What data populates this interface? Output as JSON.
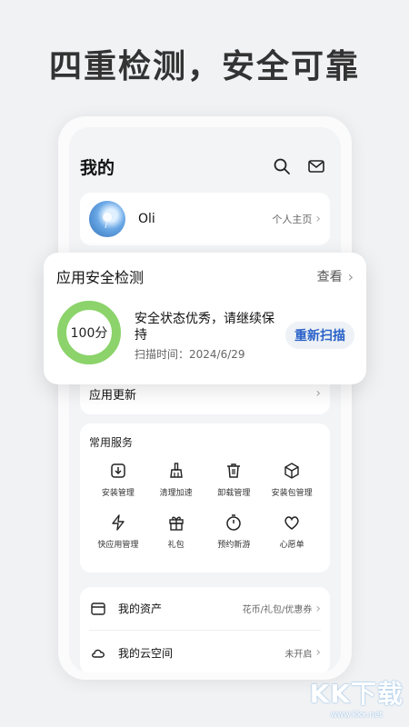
{
  "headline": "四重检测，安全可靠",
  "header": {
    "title": "我的",
    "icons": [
      "search-icon",
      "mail-icon"
    ]
  },
  "profile": {
    "name": "Oli",
    "homepage_link": "个人主页"
  },
  "security_popup": {
    "title": "应用安全检测",
    "view_link": "查看",
    "score": "100分",
    "score_percent": 100,
    "status": "安全状态优秀，请继续保持",
    "scan_time": "扫描时间：2024/6/29",
    "rescan_button": "重新扫描",
    "accent_color": "#8bd36a"
  },
  "app_update": {
    "label": "应用更新"
  },
  "services": {
    "title": "常用服务",
    "items": [
      {
        "label": "安装管理",
        "icon": "install-icon"
      },
      {
        "label": "清理加速",
        "icon": "broom-icon"
      },
      {
        "label": "卸载管理",
        "icon": "trash-icon"
      },
      {
        "label": "安装包管理",
        "icon": "package-icon"
      },
      {
        "label": "快应用管理",
        "icon": "lightning-icon"
      },
      {
        "label": "礼包",
        "icon": "gift-icon"
      },
      {
        "label": "预约新游",
        "icon": "timer-icon"
      },
      {
        "label": "心愿单",
        "icon": "heart-icon"
      }
    ]
  },
  "assets": [
    {
      "label": "我的资产",
      "value": "花币/礼包/优惠券",
      "icon": "wallet-icon"
    },
    {
      "label": "我的云空间",
      "value": "未开启",
      "icon": "cloud-icon"
    }
  ],
  "watermark": {
    "logo": "KK下载",
    "url": "www.kkx.net"
  }
}
